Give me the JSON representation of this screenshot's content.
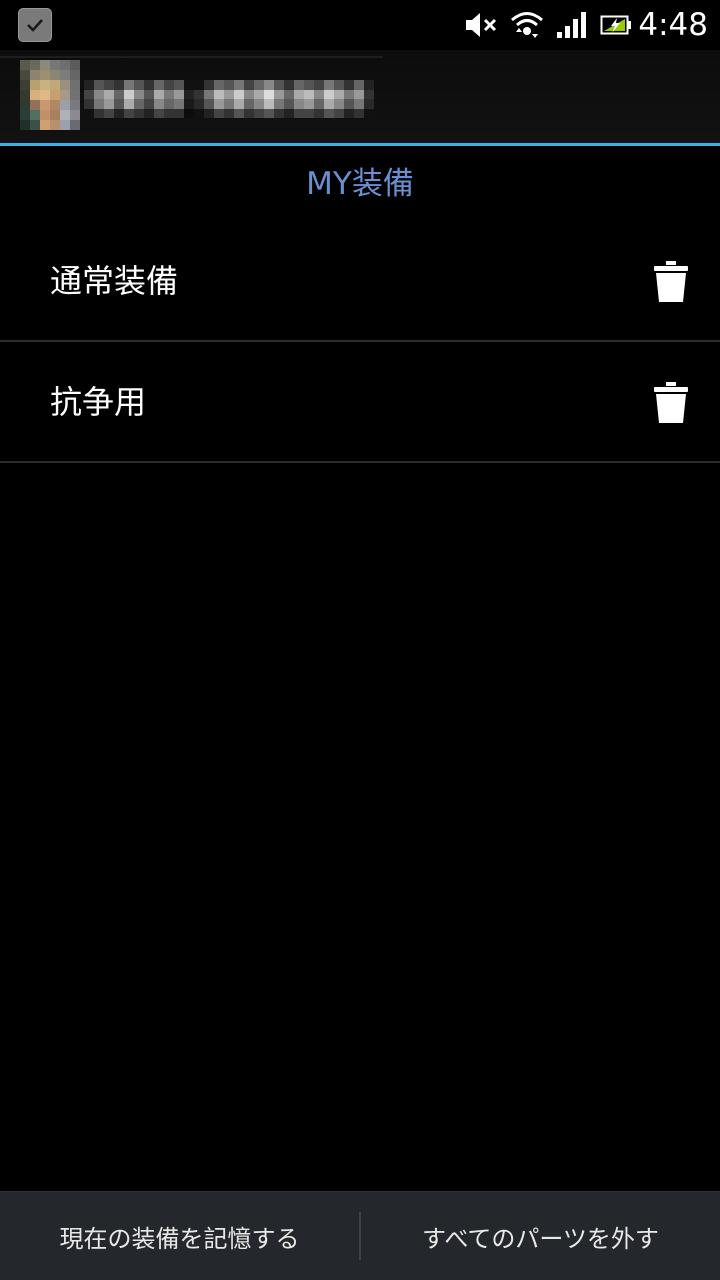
{
  "status_bar": {
    "time": "4:48",
    "icons": [
      "notification-check-icon",
      "mute-icon",
      "wifi-icon",
      "signal-icon",
      "battery-charging-icon"
    ]
  },
  "header": {
    "accent_color": "#33b5e5",
    "background": "#0f0f0f"
  },
  "page": {
    "title": "MY装備",
    "title_color": "#6a8fd0"
  },
  "list": {
    "items": [
      {
        "label": "通常装備",
        "action_icon": "trash-icon"
      },
      {
        "label": "抗争用",
        "action_icon": "trash-icon"
      }
    ]
  },
  "bottom_bar": {
    "left_label": "現在の装備を記憶する",
    "right_label": "すべてのパーツを外す"
  }
}
